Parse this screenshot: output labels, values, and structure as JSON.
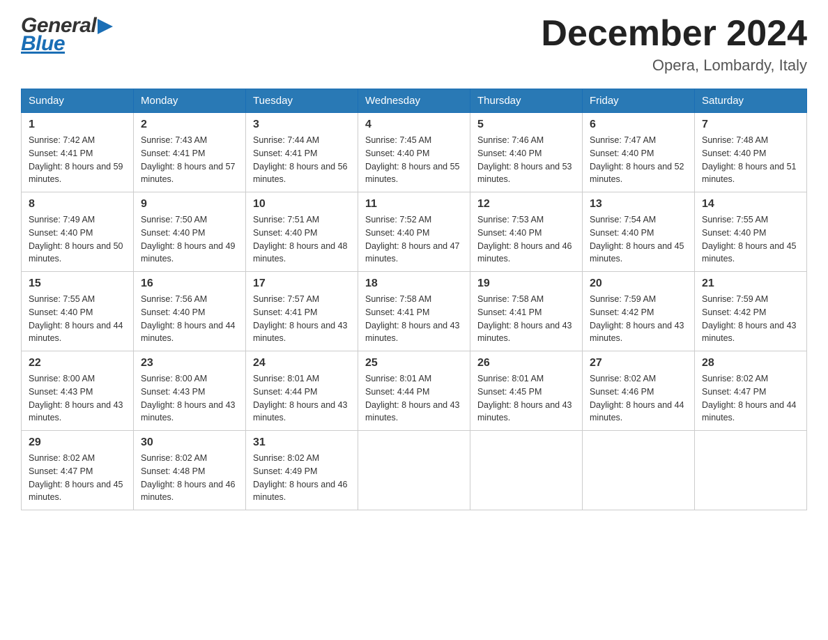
{
  "header": {
    "month_title": "December 2024",
    "location": "Opera, Lombardy, Italy",
    "logo_general": "General",
    "logo_blue": "Blue"
  },
  "days_of_week": [
    "Sunday",
    "Monday",
    "Tuesday",
    "Wednesday",
    "Thursday",
    "Friday",
    "Saturday"
  ],
  "weeks": [
    [
      {
        "day": "1",
        "sunrise": "7:42 AM",
        "sunset": "4:41 PM",
        "daylight": "8 hours and 59 minutes."
      },
      {
        "day": "2",
        "sunrise": "7:43 AM",
        "sunset": "4:41 PM",
        "daylight": "8 hours and 57 minutes."
      },
      {
        "day": "3",
        "sunrise": "7:44 AM",
        "sunset": "4:41 PM",
        "daylight": "8 hours and 56 minutes."
      },
      {
        "day": "4",
        "sunrise": "7:45 AM",
        "sunset": "4:40 PM",
        "daylight": "8 hours and 55 minutes."
      },
      {
        "day": "5",
        "sunrise": "7:46 AM",
        "sunset": "4:40 PM",
        "daylight": "8 hours and 53 minutes."
      },
      {
        "day": "6",
        "sunrise": "7:47 AM",
        "sunset": "4:40 PM",
        "daylight": "8 hours and 52 minutes."
      },
      {
        "day": "7",
        "sunrise": "7:48 AM",
        "sunset": "4:40 PM",
        "daylight": "8 hours and 51 minutes."
      }
    ],
    [
      {
        "day": "8",
        "sunrise": "7:49 AM",
        "sunset": "4:40 PM",
        "daylight": "8 hours and 50 minutes."
      },
      {
        "day": "9",
        "sunrise": "7:50 AM",
        "sunset": "4:40 PM",
        "daylight": "8 hours and 49 minutes."
      },
      {
        "day": "10",
        "sunrise": "7:51 AM",
        "sunset": "4:40 PM",
        "daylight": "8 hours and 48 minutes."
      },
      {
        "day": "11",
        "sunrise": "7:52 AM",
        "sunset": "4:40 PM",
        "daylight": "8 hours and 47 minutes."
      },
      {
        "day": "12",
        "sunrise": "7:53 AM",
        "sunset": "4:40 PM",
        "daylight": "8 hours and 46 minutes."
      },
      {
        "day": "13",
        "sunrise": "7:54 AM",
        "sunset": "4:40 PM",
        "daylight": "8 hours and 45 minutes."
      },
      {
        "day": "14",
        "sunrise": "7:55 AM",
        "sunset": "4:40 PM",
        "daylight": "8 hours and 45 minutes."
      }
    ],
    [
      {
        "day": "15",
        "sunrise": "7:55 AM",
        "sunset": "4:40 PM",
        "daylight": "8 hours and 44 minutes."
      },
      {
        "day": "16",
        "sunrise": "7:56 AM",
        "sunset": "4:40 PM",
        "daylight": "8 hours and 44 minutes."
      },
      {
        "day": "17",
        "sunrise": "7:57 AM",
        "sunset": "4:41 PM",
        "daylight": "8 hours and 43 minutes."
      },
      {
        "day": "18",
        "sunrise": "7:58 AM",
        "sunset": "4:41 PM",
        "daylight": "8 hours and 43 minutes."
      },
      {
        "day": "19",
        "sunrise": "7:58 AM",
        "sunset": "4:41 PM",
        "daylight": "8 hours and 43 minutes."
      },
      {
        "day": "20",
        "sunrise": "7:59 AM",
        "sunset": "4:42 PM",
        "daylight": "8 hours and 43 minutes."
      },
      {
        "day": "21",
        "sunrise": "7:59 AM",
        "sunset": "4:42 PM",
        "daylight": "8 hours and 43 minutes."
      }
    ],
    [
      {
        "day": "22",
        "sunrise": "8:00 AM",
        "sunset": "4:43 PM",
        "daylight": "8 hours and 43 minutes."
      },
      {
        "day": "23",
        "sunrise": "8:00 AM",
        "sunset": "4:43 PM",
        "daylight": "8 hours and 43 minutes."
      },
      {
        "day": "24",
        "sunrise": "8:01 AM",
        "sunset": "4:44 PM",
        "daylight": "8 hours and 43 minutes."
      },
      {
        "day": "25",
        "sunrise": "8:01 AM",
        "sunset": "4:44 PM",
        "daylight": "8 hours and 43 minutes."
      },
      {
        "day": "26",
        "sunrise": "8:01 AM",
        "sunset": "4:45 PM",
        "daylight": "8 hours and 43 minutes."
      },
      {
        "day": "27",
        "sunrise": "8:02 AM",
        "sunset": "4:46 PM",
        "daylight": "8 hours and 44 minutes."
      },
      {
        "day": "28",
        "sunrise": "8:02 AM",
        "sunset": "4:47 PM",
        "daylight": "8 hours and 44 minutes."
      }
    ],
    [
      {
        "day": "29",
        "sunrise": "8:02 AM",
        "sunset": "4:47 PM",
        "daylight": "8 hours and 45 minutes."
      },
      {
        "day": "30",
        "sunrise": "8:02 AM",
        "sunset": "4:48 PM",
        "daylight": "8 hours and 46 minutes."
      },
      {
        "day": "31",
        "sunrise": "8:02 AM",
        "sunset": "4:49 PM",
        "daylight": "8 hours and 46 minutes."
      },
      null,
      null,
      null,
      null
    ]
  ],
  "labels": {
    "sunrise": "Sunrise:",
    "sunset": "Sunset:",
    "daylight": "Daylight:"
  }
}
